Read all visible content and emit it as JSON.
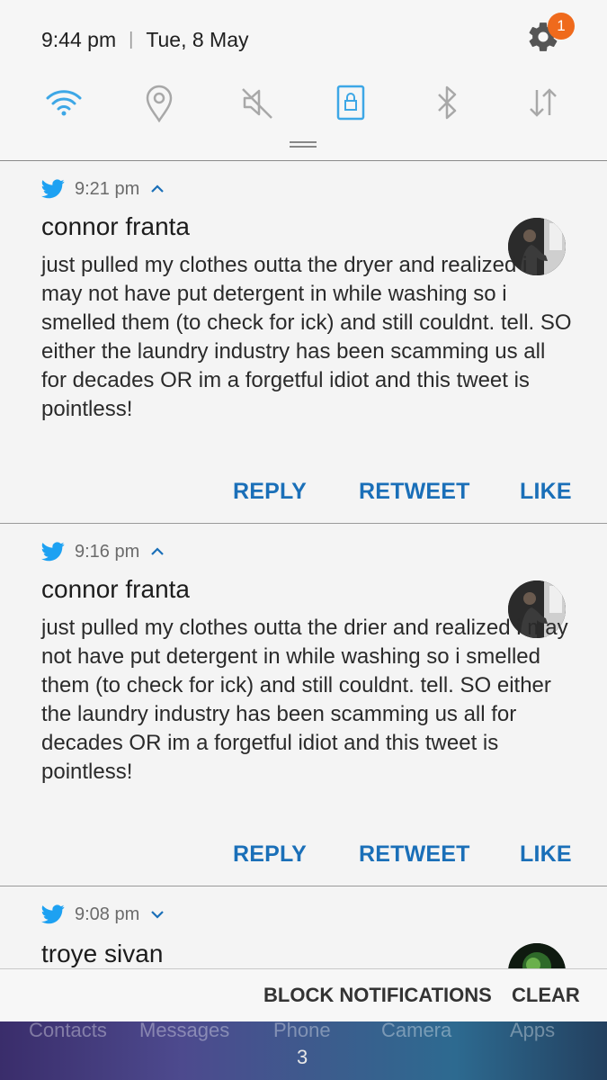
{
  "status": {
    "time": "9:44 pm",
    "date": "Tue, 8 May",
    "settings_badge": "1"
  },
  "quick_settings": {
    "icons": [
      "wifi-icon",
      "location-icon",
      "sound-muted-icon",
      "screen-lock-icon",
      "bluetooth-icon",
      "data-transfer-icon"
    ],
    "accent_color": "#3da7e6"
  },
  "notifications": [
    {
      "time": "9:21 pm",
      "author": "connor franta",
      "body": "just pulled my clothes outta the dryer and realized i may not have put detergent in while washing so i smelled them (to check for ick) and still couldnt. tell. SO either the laundry industry has been scamming us all for decades OR im a forgetful idiot and this tweet is pointless!",
      "expanded": true,
      "actions": [
        "REPLY",
        "RETWEET",
        "LIKE"
      ]
    },
    {
      "time": "9:16 pm",
      "author": "connor franta",
      "body": "just pulled my clothes outta the drier and realized i may not have put detergent in while washing so i smelled them (to check for ick) and still couldnt. tell. SO either the laundry industry has been scamming us all for decades OR im a forgetful idiot and this tweet is pointless!",
      "expanded": true,
      "actions": [
        "REPLY",
        "RETWEET",
        "LIKE"
      ]
    },
    {
      "time": "9:08 pm",
      "author": "troye sivan",
      "expanded": false
    }
  ],
  "bottom_bar": {
    "block": "BLOCK NOTIFICATIONS",
    "clear": "CLEAR"
  },
  "home": {
    "labels": [
      "Contacts",
      "Messages",
      "Phone",
      "Camera",
      "Apps"
    ],
    "page": "3"
  },
  "colors": {
    "twitter_blue": "#1da1f2",
    "action_blue": "#1a6fb8",
    "badge_orange": "#ef6a1c"
  }
}
